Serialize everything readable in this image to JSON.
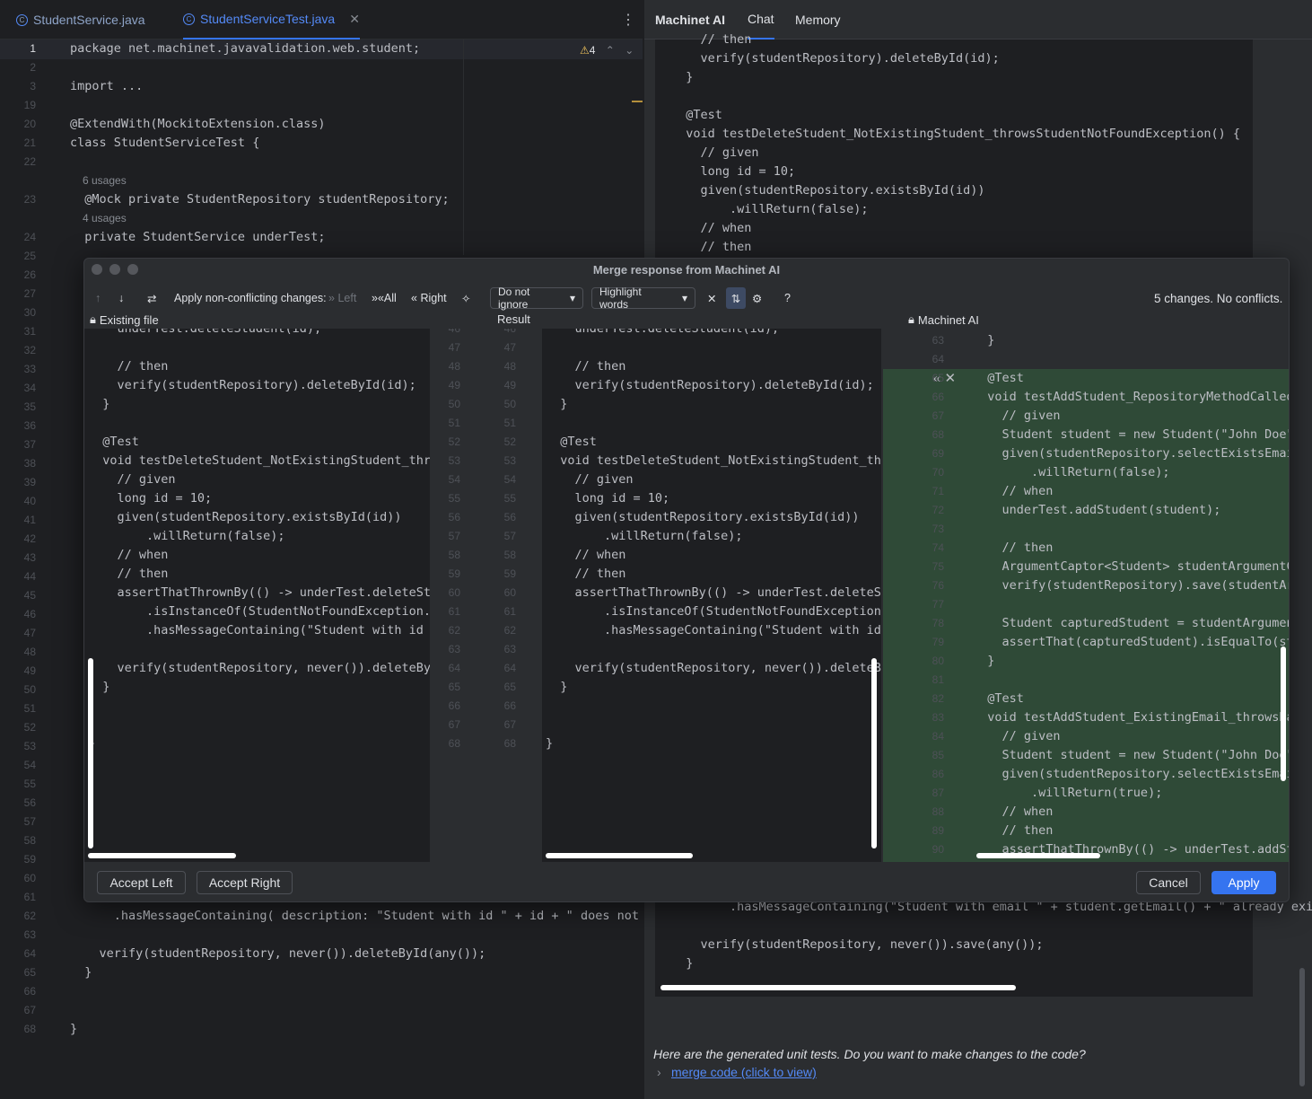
{
  "editor": {
    "tabs": [
      {
        "label": "StudentService.java"
      },
      {
        "label": "StudentServiceTest.java"
      }
    ],
    "warnings": "4",
    "lines": [
      {
        "n": "1",
        "code": "package net.machinet.javavalidation.web.student;"
      },
      {
        "n": "2",
        "code": ""
      },
      {
        "n": "3",
        "code": "import ..."
      },
      {
        "n": "19",
        "code": ""
      },
      {
        "n": "20",
        "code": "@ExtendWith(MockitoExtension.class)"
      },
      {
        "n": "21",
        "code": "class StudentServiceTest {"
      },
      {
        "n": "22",
        "code": ""
      },
      {
        "n": "23",
        "code": "  @Mock private StudentRepository studentRepository;"
      },
      {
        "n": "24",
        "code": "  private StudentService underTest;"
      },
      {
        "n": "25",
        "code": ""
      },
      {
        "n": "26",
        "code": ""
      },
      {
        "n": "27",
        "code": ""
      },
      {
        "n": "30",
        "code": ""
      },
      {
        "n": "31",
        "code": ""
      },
      {
        "n": "32",
        "code": ""
      },
      {
        "n": "33",
        "code": ""
      },
      {
        "n": "34",
        "code": ""
      },
      {
        "n": "35",
        "code": ""
      },
      {
        "n": "36",
        "code": ""
      },
      {
        "n": "37",
        "code": ""
      },
      {
        "n": "38",
        "code": ""
      },
      {
        "n": "39",
        "code": ""
      },
      {
        "n": "40",
        "code": ""
      },
      {
        "n": "41",
        "code": ""
      },
      {
        "n": "42",
        "code": ""
      },
      {
        "n": "43",
        "code": ""
      },
      {
        "n": "44",
        "code": ""
      },
      {
        "n": "45",
        "code": ""
      },
      {
        "n": "46",
        "code": ""
      },
      {
        "n": "47",
        "code": ""
      },
      {
        "n": "48",
        "code": ""
      },
      {
        "n": "49",
        "code": ""
      },
      {
        "n": "50",
        "code": ""
      },
      {
        "n": "51",
        "code": ""
      },
      {
        "n": "52",
        "code": ""
      },
      {
        "n": "53",
        "code": ""
      },
      {
        "n": "54",
        "code": ""
      },
      {
        "n": "55",
        "code": ""
      },
      {
        "n": "56",
        "code": ""
      },
      {
        "n": "57",
        "code": ""
      },
      {
        "n": "58",
        "code": ""
      },
      {
        "n": "59",
        "code": ""
      },
      {
        "n": "60",
        "code": ""
      },
      {
        "n": "61",
        "code": ""
      },
      {
        "n": "62",
        "code": "      .hasMessageContaining( description: \"Student with id \" + id + \" does not exists\");"
      },
      {
        "n": "63",
        "code": ""
      },
      {
        "n": "64",
        "code": "    verify(studentRepository, never()).deleteById(any());"
      },
      {
        "n": "65",
        "code": "  }"
      },
      {
        "n": "66",
        "code": ""
      },
      {
        "n": "67",
        "code": ""
      },
      {
        "n": "68",
        "code": "}"
      }
    ],
    "usages1": "6 usages",
    "usages2": "4 usages"
  },
  "panel": {
    "tabs": [
      {
        "label": "Machinet AI"
      },
      {
        "label": "Chat"
      },
      {
        "label": "Memory"
      }
    ],
    "code_top": [
      "    // then",
      "    verify(studentRepository).deleteById(id);",
      "  }",
      "",
      "  @Test",
      "  void testDeleteStudent_NotExistingStudent_throwsStudentNotFoundException() {",
      "    // given",
      "    long id = 10;",
      "    given(studentRepository.existsById(id))",
      "        .willReturn(false);",
      "    // when",
      "    // then"
    ],
    "code_bottom": [
      "        .hasMessageContaining(\"Student with email \" + student.getEmail() + \" already exists\");",
      "",
      "    verify(studentRepository, never()).save(any());",
      "  }"
    ],
    "message": "Here are the generated unit tests. Do you want to make changes to the code?",
    "merge_link": "merge code (click to view)"
  },
  "dialog": {
    "title": "Merge response from Machinet AI",
    "toolbar": {
      "apply_label": "Apply non-conflicting changes:",
      "left": "Left",
      "all": "All",
      "right": "Right",
      "ignore": "Do not ignore",
      "highlight": "Highlight words",
      "help": "?",
      "status": "5 changes. No conflicts."
    },
    "headers": {
      "left": "Existing file",
      "center": "Result",
      "right": "Machinet AI"
    },
    "left_code": [
      "    underTest.deleteStudent(id);",
      "",
      "    // then",
      "    verify(studentRepository).deleteById(id);",
      "  }",
      "",
      "  @Test",
      "  void testDeleteStudent_NotExistingStudent_throwsStude",
      "    // given",
      "    long id = 10;",
      "    given(studentRepository.existsById(id))",
      "        .willReturn(false);",
      "    // when",
      "    // then",
      "    assertThatThrownBy(() -> underTest.deleteStudent(id)",
      "        .isInstanceOf(StudentNotFoundException.class) c",
      "        .hasMessageContaining(\"Student with id \" + id + \"",
      "",
      "    verify(studentRepository, never()).deleteById(any());",
      "  }",
      "",
      "",
      "}"
    ],
    "center_code": [
      "    underTest.deleteStudent(id);",
      "",
      "    // then",
      "    verify(studentRepository).deleteById(id);",
      "  }",
      "",
      "  @Test",
      "  void testDeleteStudent_NotExistingStudent_throwsStudent",
      "    // given",
      "    long id = 10;",
      "    given(studentRepository.existsById(id))",
      "        .willReturn(false);",
      "    // when",
      "    // then",
      "    assertThatThrownBy(() -> underTest.deleteStudent(id))",
      "        .isInstanceOf(StudentNotFoundException.class) ca",
      "        .hasMessageContaining(\"Student with id \" + id + \" d",
      "",
      "    verify(studentRepository, never()).deleteById(any());",
      "  }",
      "",
      "",
      "}"
    ],
    "gutter_a": [
      "46",
      "47",
      "48",
      "49",
      "50",
      "51",
      "52",
      "53",
      "54",
      "55",
      "56",
      "57",
      "58",
      "59",
      "60",
      "61",
      "62",
      "63",
      "64",
      "65",
      "66",
      "67",
      "68"
    ],
    "gutter_b": [
      "46",
      "47",
      "48",
      "49",
      "50",
      "51",
      "52",
      "53",
      "54",
      "55",
      "56",
      "57",
      "58",
      "59",
      "60",
      "61",
      "62",
      "63",
      "64",
      "65",
      "66",
      "67",
      "68"
    ],
    "right_nums": [
      "63",
      "64",
      "65",
      "66",
      "67",
      "68",
      "69",
      "70",
      "71",
      "72",
      "73",
      "74",
      "75",
      "76",
      "77",
      "78",
      "79",
      "80",
      "81",
      "82",
      "83",
      "84",
      "85",
      "86",
      "87",
      "88",
      "89",
      "90"
    ],
    "right_code": [
      "  }",
      "",
      "  @Test",
      "  void testAddStudent_RepositoryMethodCalled_Succes",
      "    // given",
      "    Student student = new Student(\"John Doe\", \"john.do",
      "    given(studentRepository.selectExistsEmail(student.g",
      "        .willReturn(false);",
      "    // when",
      "    underTest.addStudent(student);",
      "",
      "    // then",
      "    ArgumentCaptor<Student> studentArgumentCaptor",
      "    verify(studentRepository).save(studentArgumentCap",
      "",
      "    Student capturedStudent = studentArgumentCaptor",
      "    assertThat(capturedStudent).isEqualTo(student);",
      "  }",
      "",
      "  @Test",
      "  void testAddStudent_ExistingEmail_throwsBadReque",
      "    // given",
      "    Student student = new Student(\"John Doe\", \"john.",
      "    given(studentRepository.selectExistsEmail(studen",
      "        .willReturn(true);",
      "    // when",
      "    // then",
      "    assertThatThrownBy(() -> underTest.addStudent(st"
    ],
    "buttons": {
      "accept_left": "Accept Left",
      "accept_right": "Accept Right",
      "cancel": "Cancel",
      "apply": "Apply"
    }
  },
  "colors": {
    "accent": "#3574f0",
    "added": "#2f4a37",
    "keyword": "#cf8e6d",
    "string": "#6aab73",
    "field": "#c77dbb",
    "annotation": "#b3ae60"
  }
}
